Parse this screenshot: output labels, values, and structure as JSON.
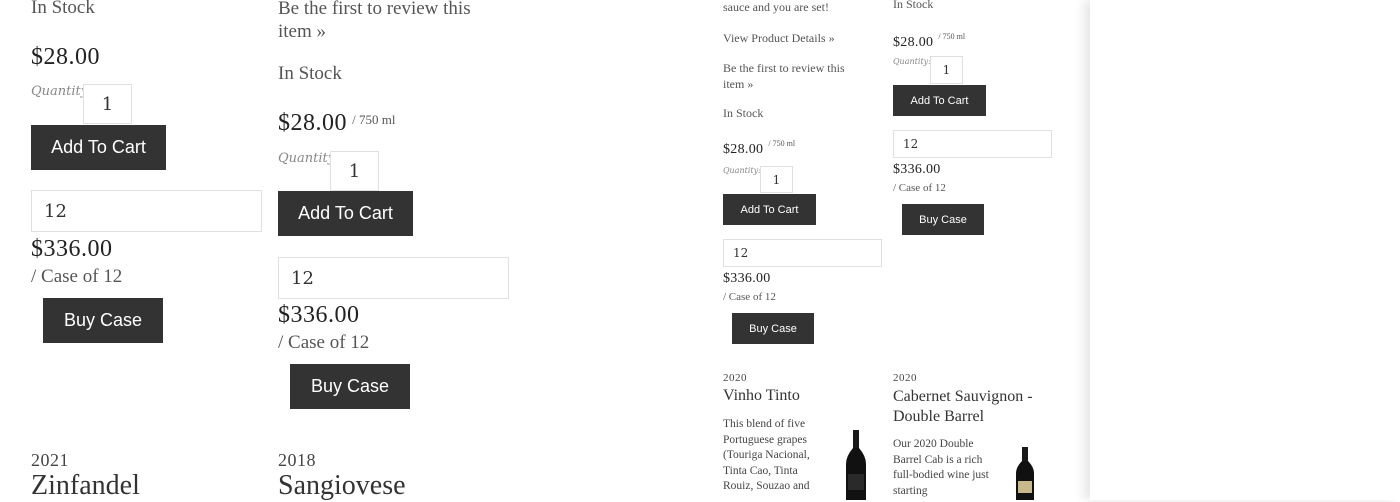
{
  "col1": {
    "stock": "In Stock",
    "price": "$28.00",
    "quantity_label": "Quantity:",
    "quantity_value": "1",
    "add_to_cart": "Add To Cart",
    "case_qty": "12",
    "case_price": "$336.00",
    "case_unit": "/ Case of 12",
    "buy_case": "Buy Case",
    "year": "2021",
    "name": "Zinfandel"
  },
  "col2": {
    "review_link": "Be the first to review this item »",
    "stock": "In Stock",
    "price": "$28.00",
    "unit": "/ 750 ml",
    "quantity_label": "Quantity:",
    "quantity_value": "1",
    "add_to_cart": "Add To Cart",
    "case_qty": "12",
    "case_price": "$336.00",
    "case_unit": "/ Case of 12",
    "buy_case": "Buy Case",
    "year": "2018",
    "name": "Sangiovese"
  },
  "col3": {
    "desc_tail": "sauce and you are set!",
    "details_link": "View Product Details »",
    "review_link": "Be the first to review this item »",
    "stock": "In Stock",
    "price": "$28.00",
    "unit": "/ 750 ml",
    "quantity_label": "Quantity:",
    "quantity_value": "1",
    "add_to_cart": "Add To Cart",
    "case_qty": "12",
    "case_price": "$336.00",
    "case_unit": "/ Case of 12",
    "buy_case": "Buy Case",
    "year": "2020",
    "name": "Vinho Tinto",
    "description": "This blend of five Portuguese grapes (Touriga Nacional, Tinta Cao, Tinta Rouiz, Souzao and"
  },
  "col4": {
    "stock": "In Stock",
    "price": "$28.00",
    "unit": "/ 750 ml",
    "quantity_label": "Quantity:",
    "quantity_value": "1",
    "add_to_cart": "Add To Cart",
    "case_qty": "12",
    "case_price": "$336.00",
    "case_unit": "/ Case of 12",
    "buy_case": "Buy Case",
    "year": "2020",
    "name": "Cabernet Sauvignon - Double Barrel",
    "description": "Our 2020 Double Barrel Cab is a rich full-bodied wine just starting"
  },
  "colors": {
    "button_bg": "#333333",
    "button_text": "#ffffff",
    "text": "#333333",
    "border": "#e0e0e0"
  }
}
